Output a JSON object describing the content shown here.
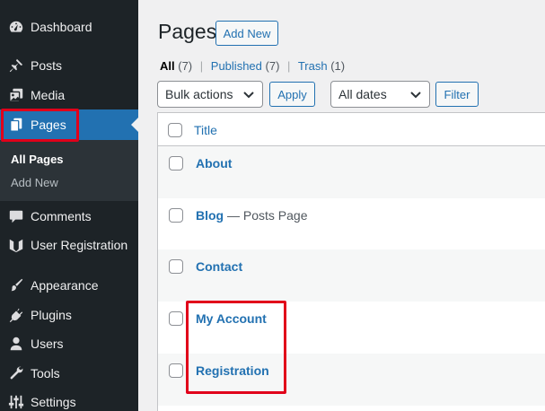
{
  "sidebar": {
    "items": [
      {
        "label": "Dashboard",
        "icon": "dashboard-icon"
      },
      {
        "label": "Posts",
        "icon": "pin-icon"
      },
      {
        "label": "Media",
        "icon": "media-icon"
      },
      {
        "label": "Pages",
        "icon": "pages-icon"
      },
      {
        "label": "Comments",
        "icon": "comment-icon"
      },
      {
        "label": "User Registration",
        "icon": "user-registration-icon"
      },
      {
        "label": "Appearance",
        "icon": "brush-icon"
      },
      {
        "label": "Plugins",
        "icon": "plug-icon"
      },
      {
        "label": "Users",
        "icon": "user-icon"
      },
      {
        "label": "Tools",
        "icon": "wrench-icon"
      },
      {
        "label": "Settings",
        "icon": "sliders-icon"
      }
    ],
    "submenu": [
      {
        "label": "All Pages"
      },
      {
        "label": "Add New"
      }
    ]
  },
  "header": {
    "title": "Pages",
    "add_new_label": "Add New"
  },
  "filters": {
    "all_label": "All",
    "all_count": "(7)",
    "published_label": "Published",
    "published_count": "(7)",
    "trash_label": "Trash",
    "trash_count": "(1)",
    "separator": "|"
  },
  "bulk": {
    "bulk_actions": "Bulk actions",
    "apply_label": "Apply",
    "dates": "All dates",
    "filter_label": "Filter"
  },
  "table": {
    "column_title": "Title",
    "rows": [
      {
        "title": "About",
        "state": ""
      },
      {
        "title": "Blog",
        "state": " — Posts Page"
      },
      {
        "title": "Contact",
        "state": ""
      },
      {
        "title": "My Account",
        "state": ""
      },
      {
        "title": "Registration",
        "state": ""
      }
    ]
  },
  "colors": {
    "sidebar_bg": "#1d2327",
    "accent": "#2271b1",
    "highlight": "#e1001a"
  }
}
